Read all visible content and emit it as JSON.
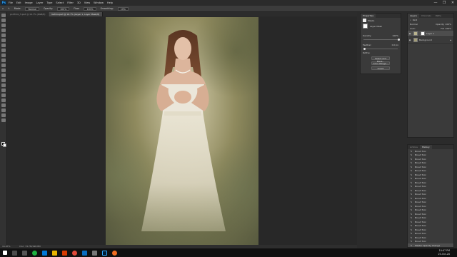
{
  "menubar": {
    "app_icon": "Ps",
    "items": [
      "File",
      "Edit",
      "Image",
      "Layer",
      "Type",
      "Select",
      "Filter",
      "3D",
      "View",
      "Window",
      "Help"
    ],
    "window_controls": [
      "—",
      "❐",
      "✕"
    ]
  },
  "options": {
    "mode_label": "Mode:",
    "mode_value": "Normal",
    "opacity_label": "Opacity:",
    "opacity_value": "100%",
    "flow_label": "Flow:",
    "flow_value": "100%",
    "smoothing_label": "Smoothing:",
    "smoothing_value": "10%"
  },
  "tabs": [
    {
      "label": "portfolio_5.psd @ 16.7% (RGB/8)",
      "active": false
    },
    {
      "label": "before.psd @ 16.7% (Layer 1, Layer Mask/8)",
      "active": true
    }
  ],
  "status": {
    "zoom": "16.67%",
    "doc": "Doc: 74.7M/198.8M"
  },
  "properties": {
    "tabs": [
      "Properties"
    ],
    "section": "Masks",
    "mask_label": "Layer Mask",
    "density_label": "Density:",
    "density_value": "100%",
    "feather_label": "Feather:",
    "feather_value": "0.0 px",
    "refine_label": "Refine:",
    "buttons": [
      "Select and Mask...",
      "Color Range...",
      "Invert"
    ]
  },
  "layers": {
    "tabs": [
      "Layers",
      "Channels",
      "Paths"
    ],
    "kind_label": "Kind",
    "blend": "Normal",
    "opacity_label": "Opacity:",
    "opacity_value": "100%",
    "lock_label": "Lock:",
    "fill_label": "Fill:",
    "fill_value": "100%",
    "items": [
      {
        "name": "Layer 1",
        "selected": true
      },
      {
        "name": "Background",
        "selected": false
      }
    ]
  },
  "history": {
    "tabs": [
      "Actions",
      "History"
    ],
    "items": [
      "Brush Tool",
      "Brush Tool",
      "Brush Tool",
      "Brush Tool",
      "Brush Tool",
      "Brush Tool",
      "Brush Tool",
      "Brush Tool",
      "Brush Tool",
      "Brush Tool",
      "Brush Tool",
      "Brush Tool",
      "Brush Tool",
      "Brush Tool",
      "Brush Tool",
      "Brush Tool",
      "Brush Tool",
      "Brush Tool",
      "Brush Tool",
      "Brush Tool",
      "Brush Tool",
      "Brush Tool",
      "Brush Tool",
      "Brush Tool",
      "Master Opacity Change"
    ]
  },
  "tray": {
    "time": "10:07 PM",
    "date": "25-Oct-20"
  },
  "colors": {
    "accent": "#31a8ff",
    "panel": "#3a3a3a",
    "canvas_bg": "#282828"
  },
  "icons": {
    "brush": "brush-icon",
    "eye": "eye-icon",
    "search": "search-icon"
  }
}
